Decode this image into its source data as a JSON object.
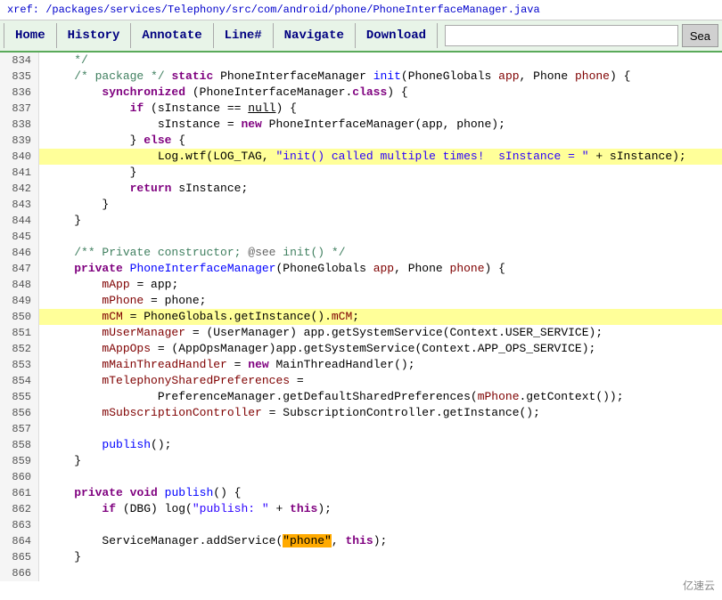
{
  "pathbar": {
    "text": "xref: /packages/services/Telephony/src/com/android/phone/PhoneInterfaceManager.java"
  },
  "nav": {
    "items": [
      "Home",
      "History",
      "Annotate",
      "Line#",
      "Navigate",
      "Download"
    ],
    "search_placeholder": "",
    "search_button": "Sea"
  },
  "watermark": "亿速云"
}
